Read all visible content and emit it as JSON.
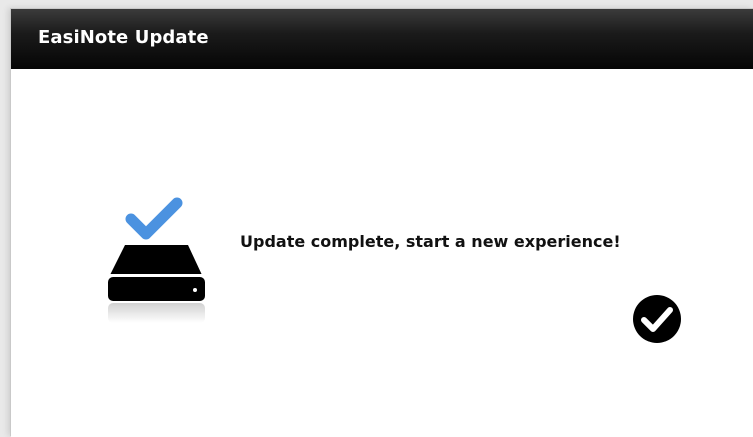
{
  "window": {
    "title": "EasiNote Update"
  },
  "main": {
    "message": "Update complete, start a new experience!",
    "illustration_icon": "drive-check-icon",
    "confirm_icon": "checkmark-circle-icon"
  },
  "colors": {
    "titlebar_top": "#3b3b3b",
    "titlebar_bottom": "#050505",
    "check_blue": "#4b92e0",
    "icon_black": "#000000"
  }
}
